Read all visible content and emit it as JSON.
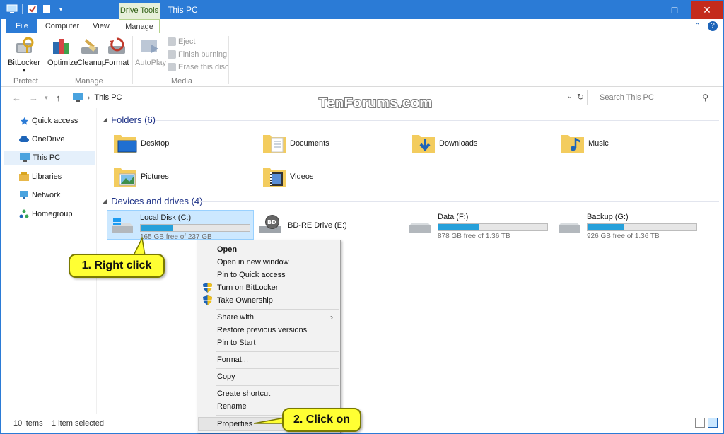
{
  "window": {
    "title": "This PC",
    "context_tab_group": "Drive Tools",
    "controls": {
      "minimize": "—",
      "maximize": "□",
      "close": "✕"
    }
  },
  "ribbon_tabs": {
    "file": "File",
    "computer": "Computer",
    "view": "View",
    "manage": "Manage"
  },
  "ribbon": {
    "bitlocker": "BitLocker",
    "optimize": "Optimize",
    "cleanup": "Cleanup",
    "format": "Format",
    "autoplay": "AutoPlay",
    "eject": "Eject",
    "finish_burning": "Finish burning",
    "erase_disc": "Erase this disc",
    "group_protect": "Protect",
    "group_manage": "Manage",
    "group_media": "Media"
  },
  "address": {
    "crumb": "This PC",
    "search_placeholder": "Search This PC"
  },
  "watermark": "TenForums.com",
  "nav_pane": [
    {
      "label": "Quick access",
      "icon": "star-icon"
    },
    {
      "label": "OneDrive",
      "icon": "cloud-icon"
    },
    {
      "label": "This PC",
      "icon": "computer-icon",
      "selected": true
    },
    {
      "label": "Libraries",
      "icon": "libraries-icon"
    },
    {
      "label": "Network",
      "icon": "network-icon"
    },
    {
      "label": "Homegroup",
      "icon": "homegroup-icon"
    }
  ],
  "sections": {
    "folders": "Folders (6)",
    "drives": "Devices and drives (4)"
  },
  "folders": [
    {
      "name": "Desktop",
      "icon": "desktop-folder-icon"
    },
    {
      "name": "Documents",
      "icon": "documents-folder-icon"
    },
    {
      "name": "Downloads",
      "icon": "downloads-folder-icon"
    },
    {
      "name": "Music",
      "icon": "music-folder-icon"
    },
    {
      "name": "Pictures",
      "icon": "pictures-folder-icon"
    },
    {
      "name": "Videos",
      "icon": "videos-folder-icon"
    }
  ],
  "drives": [
    {
      "name": "Local Disk (C:)",
      "free": "165 GB free of 237 GB",
      "used_fraction": 0.3,
      "selected": true
    },
    {
      "name": "BD-RE Drive (E:)"
    },
    {
      "name": "Data (F:)",
      "free": "878 GB free of 1.36 TB",
      "used_fraction": 0.37
    },
    {
      "name": "Backup (G:)",
      "free": "926 GB free of 1.36 TB",
      "used_fraction": 0.34
    }
  ],
  "context_menu": {
    "open": "Open",
    "open_new_window": "Open in new window",
    "pin_quick_access": "Pin to Quick access",
    "turn_on_bitlocker": "Turn on BitLocker",
    "take_ownership": "Take Ownership",
    "share_with": "Share with",
    "restore_previous": "Restore previous versions",
    "pin_to_start": "Pin to Start",
    "format": "Format...",
    "copy": "Copy",
    "create_shortcut": "Create shortcut",
    "rename": "Rename",
    "properties": "Properties"
  },
  "callouts": {
    "step1": "1. Right click",
    "step2": "2. Click on"
  },
  "status": {
    "items": "10 items",
    "selected": "1 item selected"
  },
  "colors": {
    "titlebar": "#2b7bd6",
    "drive_bar": "#26a0da",
    "callout": "#ffff33"
  }
}
